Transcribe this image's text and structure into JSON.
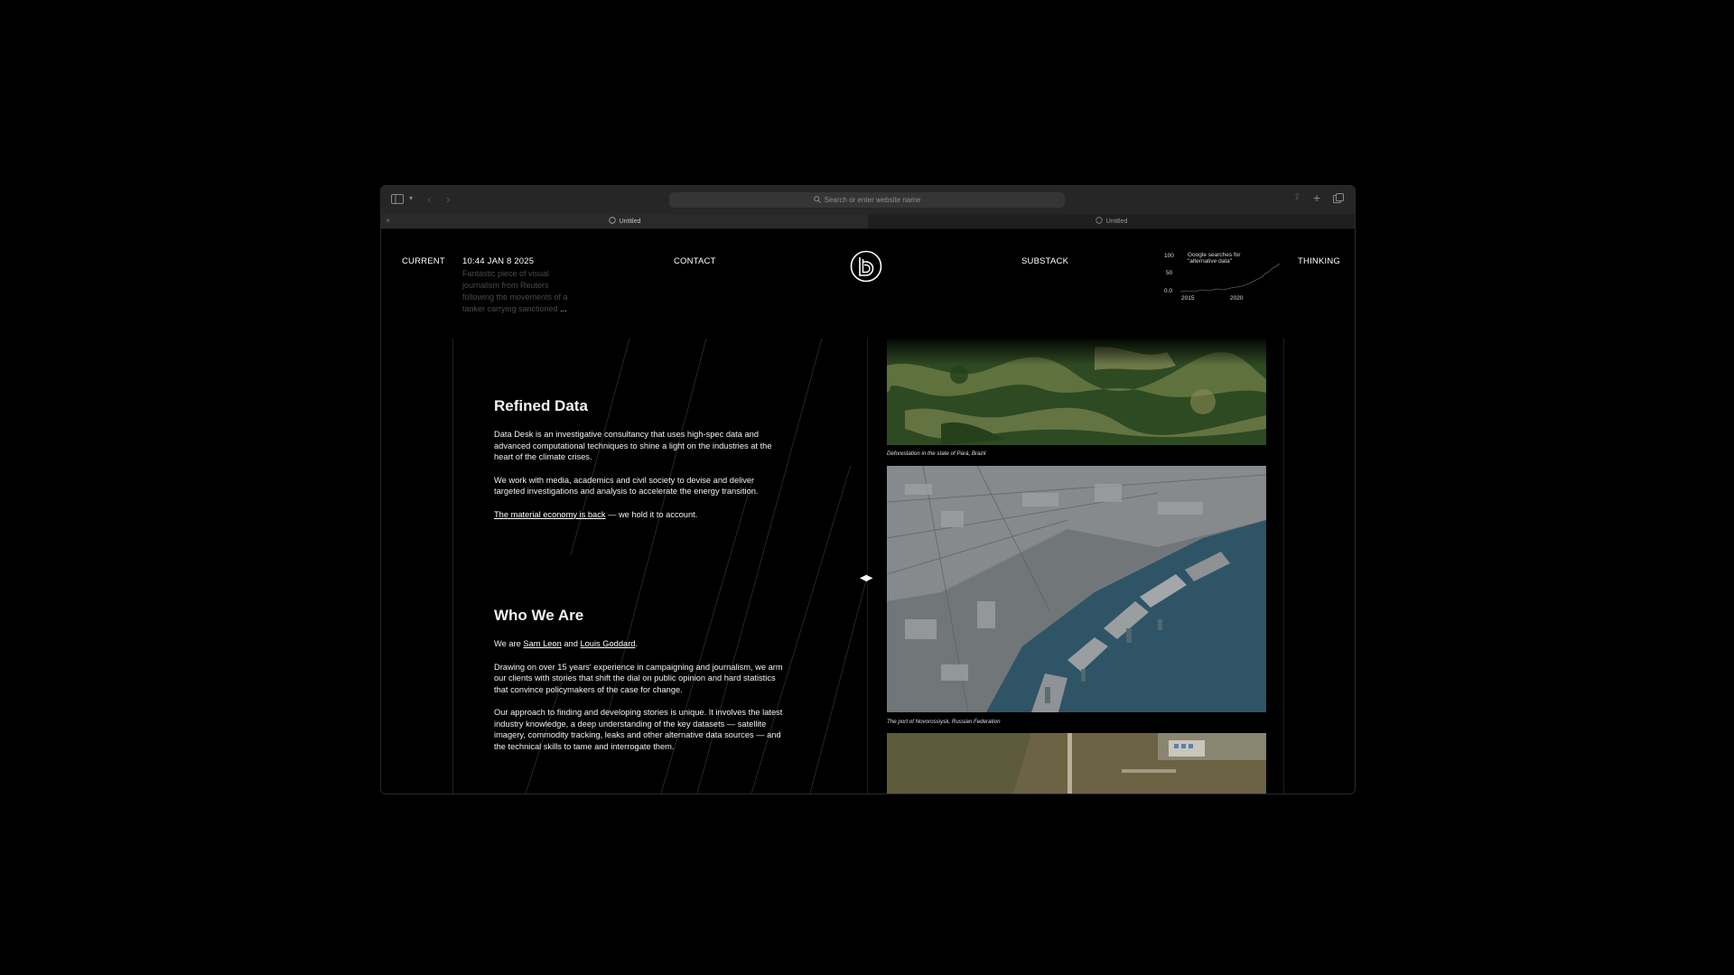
{
  "browser": {
    "address_placeholder": "Search or enter website name",
    "tabs": [
      {
        "label": "Untitled"
      },
      {
        "label": "Untitled"
      }
    ]
  },
  "nav": {
    "current": "CURRENT",
    "timestamp": "10:44 JAN 8 2025",
    "teaser": "Fantastic piece of visual journalism from Reuters following the movements of a tanker carrying sanctioned",
    "teaser_more": "...",
    "contact": "CONTACT",
    "substack": "SUBSTACK",
    "thinking": "THINKING"
  },
  "mini_chart": {
    "title": "Google searches for \"alternative data\"",
    "y_ticks": [
      "100",
      "50",
      "0.0"
    ],
    "x_ticks": [
      "2015",
      "2020"
    ],
    "line_color": "#5a5a5a"
  },
  "sections": {
    "refined": {
      "heading": "Refined Data",
      "p1": "Data Desk is an investigative consultancy that uses high-spec data and advanced computational techniques to shine a light on the industries at the heart of the climate crises.",
      "p2": "We work with media, academics and civil society to devise and deliver targeted investigations and analysis to accelerate the energy transition.",
      "p3_link": "The material economy is back",
      "p3_rest": " — we hold it to account."
    },
    "who": {
      "heading": "Who We Are",
      "p1_pre": "We are ",
      "name1": "Sam Leon",
      "p1_mid": " and ",
      "name2": "Louis Goddard",
      "p1_end": ".",
      "p2": "Drawing on over 15 years' experience in campaigning and journalism, we arm our clients with stories that shift the dial on public opinion and hard statistics that convince policymakers of the case for change.",
      "p3": "Our approach to finding and developing stories is unique. It involves the latest industry knowledge, a deep understanding of the key datasets — satellite imagery, commodity tracking, leaks and other alternative data sources — and the technical skills to tame and interrogate them."
    }
  },
  "images": {
    "caption1": "Deforestation in the state of Pará, Brazil",
    "caption2": "The port of Novorossiysk, Russian Federation"
  },
  "colors": {
    "background": "#000000",
    "text": "#ffffff",
    "muted_text": "#4a4a4a",
    "browser_chrome": "#262626",
    "sea": "#2e5466"
  }
}
